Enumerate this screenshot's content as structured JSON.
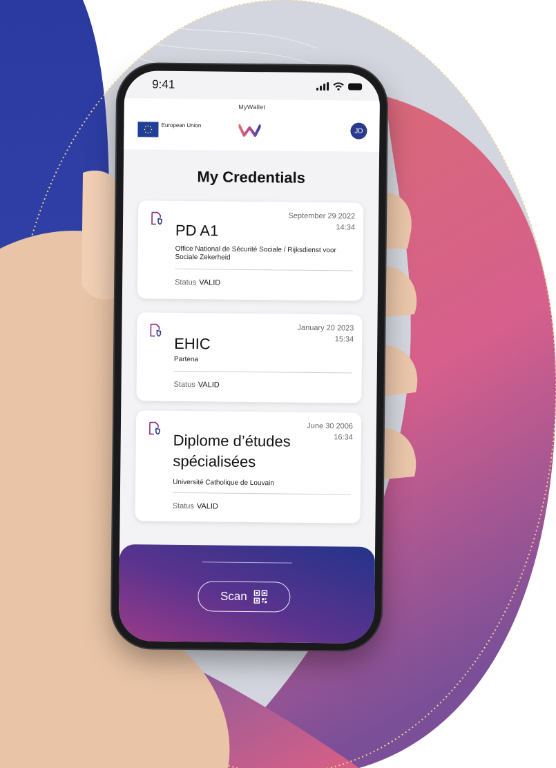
{
  "status_bar": {
    "time": "9:41"
  },
  "app": {
    "title": "MyWallet",
    "eu_label": "European Union",
    "avatar_initials": "JD",
    "page_title": "My Credentials"
  },
  "credentials": [
    {
      "date": "September 29 2022",
      "time": "14:34",
      "title": "PD A1",
      "issuer": "Office National de Sécurité Sociale / Rijksdienst voor Sociale Zekerheid",
      "status_label": "Status",
      "status_value": "VALID"
    },
    {
      "date": "January 20 2023",
      "time": "15:34",
      "title": "EHIC",
      "issuer": "Partena",
      "status_label": "Status",
      "status_value": "VALID"
    },
    {
      "date": "June 30 2006",
      "time": "16:34",
      "title": "Diplome d’études spécialisées",
      "issuer": "Université Catholique de Louvain",
      "status_label": "Status",
      "status_value": "VALID"
    }
  ],
  "bottom_bar": {
    "scan_label": "Scan"
  },
  "icons": {
    "credential": "document-shield-icon",
    "scan": "qr-code-icon"
  },
  "colors": {
    "accent_blue": "#24338a",
    "accent_purple": "#9b3b88",
    "icon_purple": "#8a2a86",
    "pink": "#e0697e"
  }
}
